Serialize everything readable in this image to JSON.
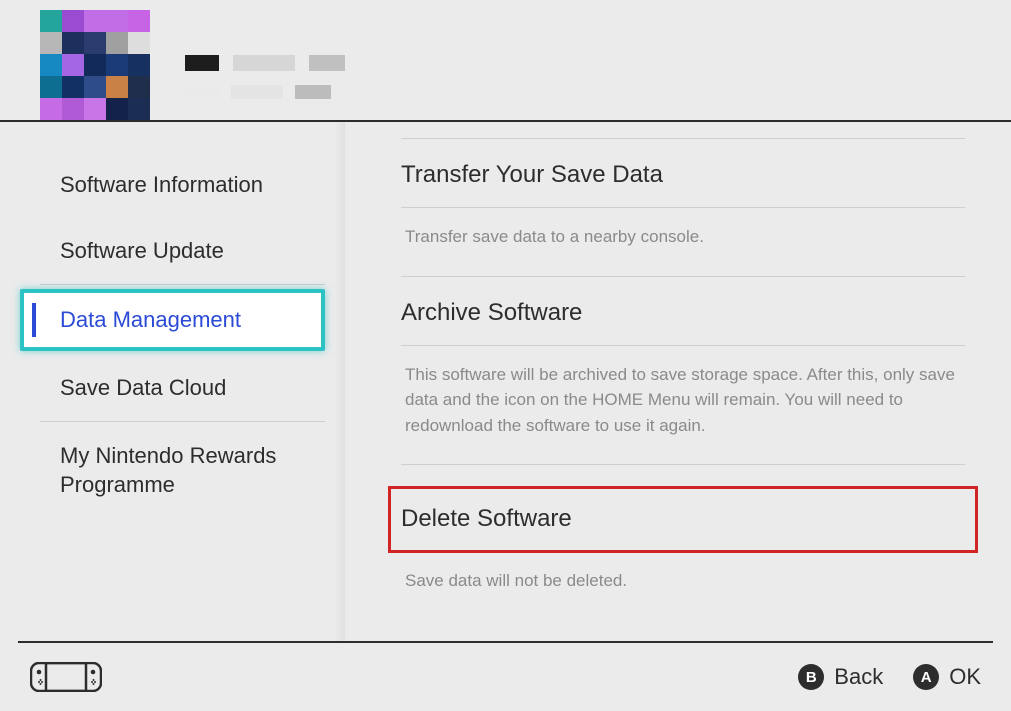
{
  "sidebar": {
    "items": [
      {
        "label": "Software Information"
      },
      {
        "label": "Software Update"
      },
      {
        "label": "Data Management",
        "selected": true
      },
      {
        "label": "Save Data Cloud"
      },
      {
        "label": "My Nintendo Rewards Programme"
      }
    ]
  },
  "content": {
    "transfer": {
      "title": "Transfer Your Save Data",
      "desc": "Transfer save data to a nearby console."
    },
    "archive": {
      "title": "Archive Software",
      "desc": "This software will be archived to save storage space. After this, only save data and the icon on the HOME Menu will remain. You will need to redownload the software to use it again."
    },
    "delete": {
      "title": "Delete Software",
      "desc": "Save data will not be deleted."
    }
  },
  "footer": {
    "back": {
      "button": "B",
      "label": "Back"
    },
    "ok": {
      "button": "A",
      "label": "OK"
    }
  }
}
